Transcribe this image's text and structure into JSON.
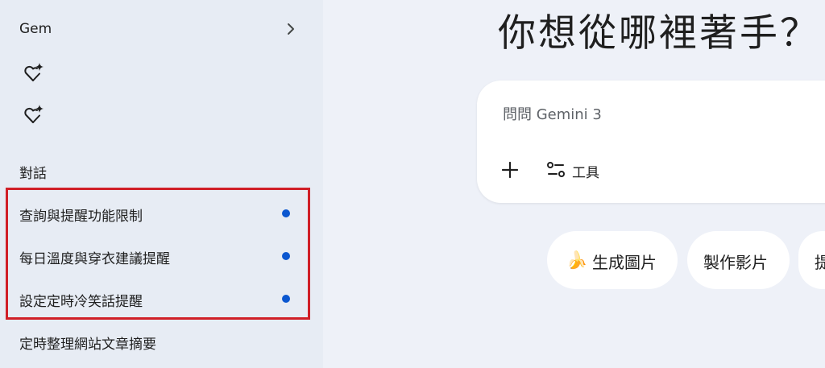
{
  "sidebar": {
    "gem": {
      "label": "Gem",
      "chevron_icon": "chevron-right-icon",
      "gem_icons": [
        "gem-sparkle-icon",
        "gem-sparkle-icon"
      ]
    },
    "conversations_heading": "對話",
    "conversations": [
      {
        "label": "查詢與提醒功能限制",
        "unread": true
      },
      {
        "label": "每日溫度與穿衣建議提醒",
        "unread": true
      },
      {
        "label": "設定定時冷笑話提醒",
        "unread": true
      },
      {
        "label": "定時整理網站文章摘要",
        "unread": false
      }
    ],
    "highlight_color": "#d01f27",
    "unread_dot_color": "#0b57d0"
  },
  "main": {
    "greeting": "你想從哪裡著手？",
    "prompt": {
      "placeholder": "問問 Gemini 3",
      "plus_icon": "plus-icon",
      "tools_icon": "tools-icon",
      "tools_label": "工具"
    },
    "chips": [
      {
        "icon": "🍌",
        "label": "生成圖片"
      },
      {
        "icon": "",
        "label": "製作影片"
      },
      {
        "icon": "",
        "label": "提"
      }
    ]
  }
}
